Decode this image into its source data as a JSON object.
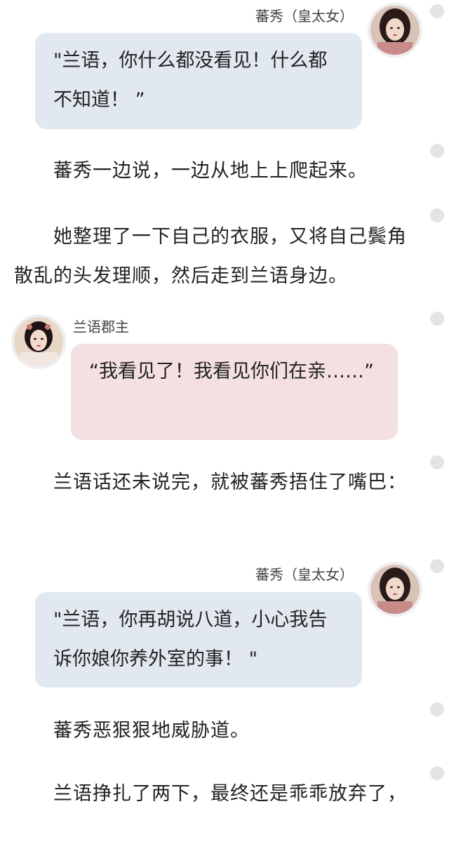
{
  "messages": [
    {
      "speaker": "蕃秀（皇太女）",
      "text": "\"兰语，你什么都没看见！什么都不知道！ ”"
    },
    {
      "speaker": "兰语郡主",
      "text": "“我看见了！我看见你们在亲……”"
    },
    {
      "speaker": "蕃秀（皇太女）",
      "text": "\"兰语，你再胡说八道，小心我告诉你娘你养外室的事！ \""
    }
  ],
  "narration": [
    "蕃秀一边说，一边从地上上爬起来。",
    "她整理了一下自己的衣服，又将自己鬓角散乱的头发理顺，然后走到兰语身边。",
    "兰语话还未说完，就被蕃秀捂住了嘴巴：",
    "蕃秀恶狠狠地威胁道。",
    "兰语挣扎了两下，最终还是乖乖放弃了，"
  ],
  "colors": {
    "bubble_blue": "#e2e8f0",
    "bubble_pink": "#f4e0e0",
    "side_dot": "#e4e4e4",
    "text": "#222222"
  },
  "icons": {
    "avatar_1": "avatar-portrait-icon",
    "avatar_2": "avatar-portrait-icon",
    "avatar_3": "avatar-portrait-icon"
  }
}
